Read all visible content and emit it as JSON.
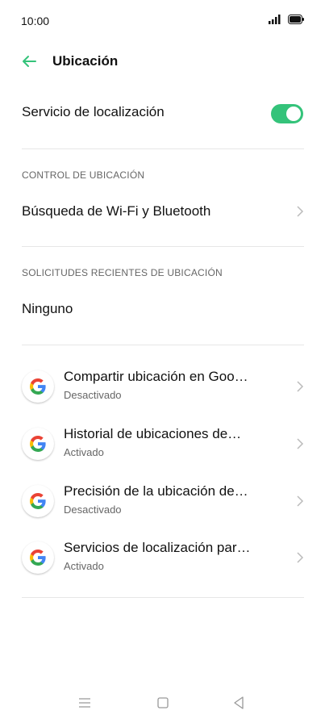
{
  "status_bar": {
    "time": "10:00"
  },
  "header": {
    "title": "Ubicación"
  },
  "location_service": {
    "label": "Servicio de localización",
    "enabled": true
  },
  "sections": {
    "control": "CONTROL DE UBICACIÓN",
    "recent": "SOLICITUDES RECIENTES DE UBICACIÓN"
  },
  "wifi_bt_scan": {
    "label": "Búsqueda de Wi-Fi y Bluetooth"
  },
  "recent_requests": {
    "none_label": "Ninguno"
  },
  "apps": [
    {
      "name": "Compartir ubicación en Goo…",
      "state": "Desactivado",
      "icon": "google-icon"
    },
    {
      "name": "Historial de ubicaciones de…",
      "state": "Activado",
      "icon": "google-icon"
    },
    {
      "name": "Precisión de la ubicación de…",
      "state": "Desactivado",
      "icon": "google-icon"
    },
    {
      "name": "Servicios de localización par…",
      "state": "Activado",
      "icon": "google-icon"
    }
  ],
  "colors": {
    "accent": "#34c37a",
    "back_arrow": "#34c37a"
  }
}
